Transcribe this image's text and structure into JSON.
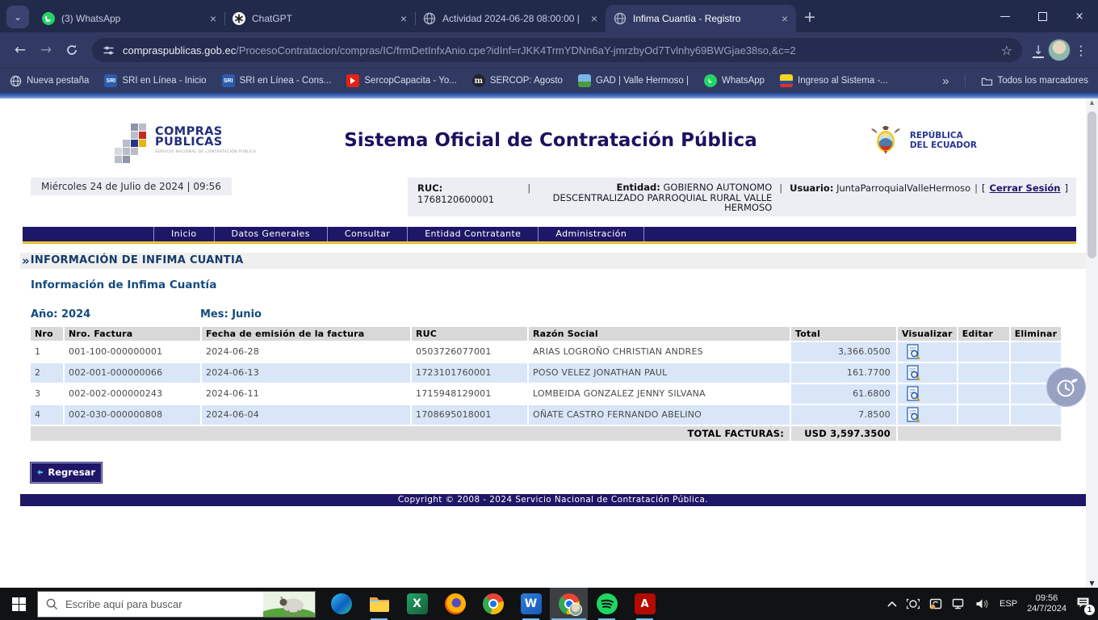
{
  "browser": {
    "tab_search_icon": "⌄",
    "tabs": [
      {
        "title": "(3) WhatsApp"
      },
      {
        "title": "ChatGPT"
      },
      {
        "title": "Actividad 2024-06-28 08:00:00 |"
      },
      {
        "title": "Infima Cuantía - Registro"
      }
    ],
    "close_glyph": "×",
    "new_tab_glyph": "+",
    "min_glyph": "—",
    "back_glyph": "←",
    "forward_glyph": "→",
    "url_domain": "compraspublicas.gob.ec",
    "url_path": "/ProcesoContratacion/compras/IC/frmDetInfxAnio.cpe?idInf=rJKK4TrmYDNn6aY-jmrzbyOd7Tvlnhy69BWGjae38so,&c=2",
    "star_glyph": "☆",
    "download_glyph": "↓",
    "kebab_glyph": "⋮",
    "bookmarks": [
      {
        "label": "Nueva pestaña"
      },
      {
        "label": "SRI en Línea - Inicio",
        "badge": "SRI"
      },
      {
        "label": "SRI en Línea - Cons...",
        "badge": "SRI"
      },
      {
        "label": "SercopCapacita - Yo..."
      },
      {
        "label": "SERCOP: Agosto",
        "badge": "m"
      },
      {
        "label": "GAD | Valle Hermoso |"
      },
      {
        "label": "WhatsApp"
      },
      {
        "label": "Ingreso al Sistema -..."
      }
    ],
    "bookmarks_overflow": "»",
    "all_bookmarks": "Todos los marcadores"
  },
  "page": {
    "logo": {
      "line1": "COMPRAS",
      "line2": "PUBLICAS",
      "tagline": "SERVICIO NACIONAL DE CONTRATACIÓN PÚBLICA"
    },
    "title": "Sistema Oficial de Contratación Pública",
    "gov": {
      "line1": "REPÚBLICA",
      "line2": "DEL ECUADOR"
    },
    "infobar": {
      "datetime": "Miércoles 24 de Julio de 2024 | 09:56",
      "ruc_label": "RUC:",
      "ruc": "1768120600001",
      "sep": "|",
      "entidad_label": "Entidad:",
      "entidad": "GOBIERNO AUTONOMO DESCENTRALIZADO PARROQUIAL RURAL VALLE HERMOSO",
      "usuario_label": "Usuario:",
      "usuario": "JuntaParroquialValleHermoso",
      "logout_open": "[",
      "logout": "Cerrar Sesión",
      "logout_close": "]"
    },
    "menu": [
      {
        "label": "Inicio"
      },
      {
        "label": "Datos Generales"
      },
      {
        "label": "Consultar"
      },
      {
        "label": "Entidad Contratante"
      },
      {
        "label": "Administración"
      }
    ],
    "breadcrumb_marker": "»",
    "breadcrumb": "INFORMACIÓN DE INFIMA CUANTIA",
    "subtitle": "Información de Infima Cuantía",
    "filters": {
      "anio": "Año: 2024",
      "mes": "Mes: Junio"
    },
    "table": {
      "headers": [
        "Nro",
        "Nro. Factura",
        "Fecha de emisión de la factura",
        "RUC",
        "Razón Social",
        "Total",
        "Visualizar",
        "Editar",
        "Eliminar"
      ],
      "rows": [
        {
          "nro": "1",
          "factura": "001-100-000000001",
          "fecha": "2024-06-28",
          "ruc": "0503726077001",
          "razon": "ARIAS LOGROÑO CHRISTIAN ANDRES",
          "total": "3,366.0500"
        },
        {
          "nro": "2",
          "factura": "002-001-000000066",
          "fecha": "2024-06-13",
          "ruc": "1723101760001",
          "razon": "POSO VELEZ JONATHAN PAUL",
          "total": "161.7700"
        },
        {
          "nro": "3",
          "factura": "002-002-000000243",
          "fecha": "2024-06-11",
          "ruc": "1715948129001",
          "razon": "LOMBEIDA GONZALEZ JENNY SILVANA",
          "total": "61.6800"
        },
        {
          "nro": "4",
          "factura": "002-030-000000808",
          "fecha": "2024-06-04",
          "ruc": "1708695018001",
          "razon": "OÑATE CASTRO FERNANDO ABELINO",
          "total": "7.8500"
        }
      ],
      "total_label": "TOTAL FACTURAS:",
      "total_value": "USD 3,597.3500"
    },
    "back_button": "Regresar",
    "footer": "Copyright © 2008 - 2024 Servicio Nacional de Contratación Pública."
  },
  "taskbar": {
    "search_placeholder": "Escribe aquí para buscar",
    "tray": {
      "lang": "ESP",
      "time": "09:56",
      "date": "24/7/2024",
      "badge": "1"
    }
  },
  "colors": {
    "navy": "#1E1666",
    "gold": "#F2C230",
    "row_blue": "#D8E6F8",
    "header_gray": "#D8D8D8",
    "chrome_dark": "#222A4C",
    "chrome_toolbar": "#303A63"
  }
}
